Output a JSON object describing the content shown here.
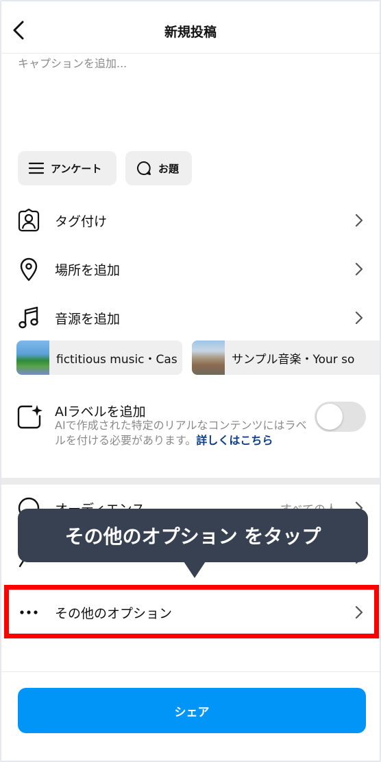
{
  "header": {
    "title": "新規投稿"
  },
  "caption": {
    "placeholder": "キャプションを追加..."
  },
  "chips": {
    "survey": "アンケート",
    "topic": "お題"
  },
  "rows": {
    "tag": "タグ付け",
    "location": "場所を追加",
    "music": "音源を追加",
    "audience": "オーディエンス",
    "audience_value": "すべての人",
    "options": "その他のオプション"
  },
  "music_suggestions": [
    {
      "text": "fictitious music・Cas"
    },
    {
      "text": "サンプル音楽・Your so"
    }
  ],
  "ai_label": {
    "title": "AIラベルを追加",
    "description": "AIで作成された特定のリアルなコンテンツにはラベルを付ける必要があります。",
    "link": "詳しくはこちら",
    "enabled": false
  },
  "tooltip": {
    "text": "その他のオプション をタップ"
  },
  "share": {
    "label": "シェア"
  },
  "colors": {
    "accent": "#0095f6",
    "highlight": "#ff0000",
    "tooltip_bg": "#374151",
    "link": "#0b3e8c"
  }
}
